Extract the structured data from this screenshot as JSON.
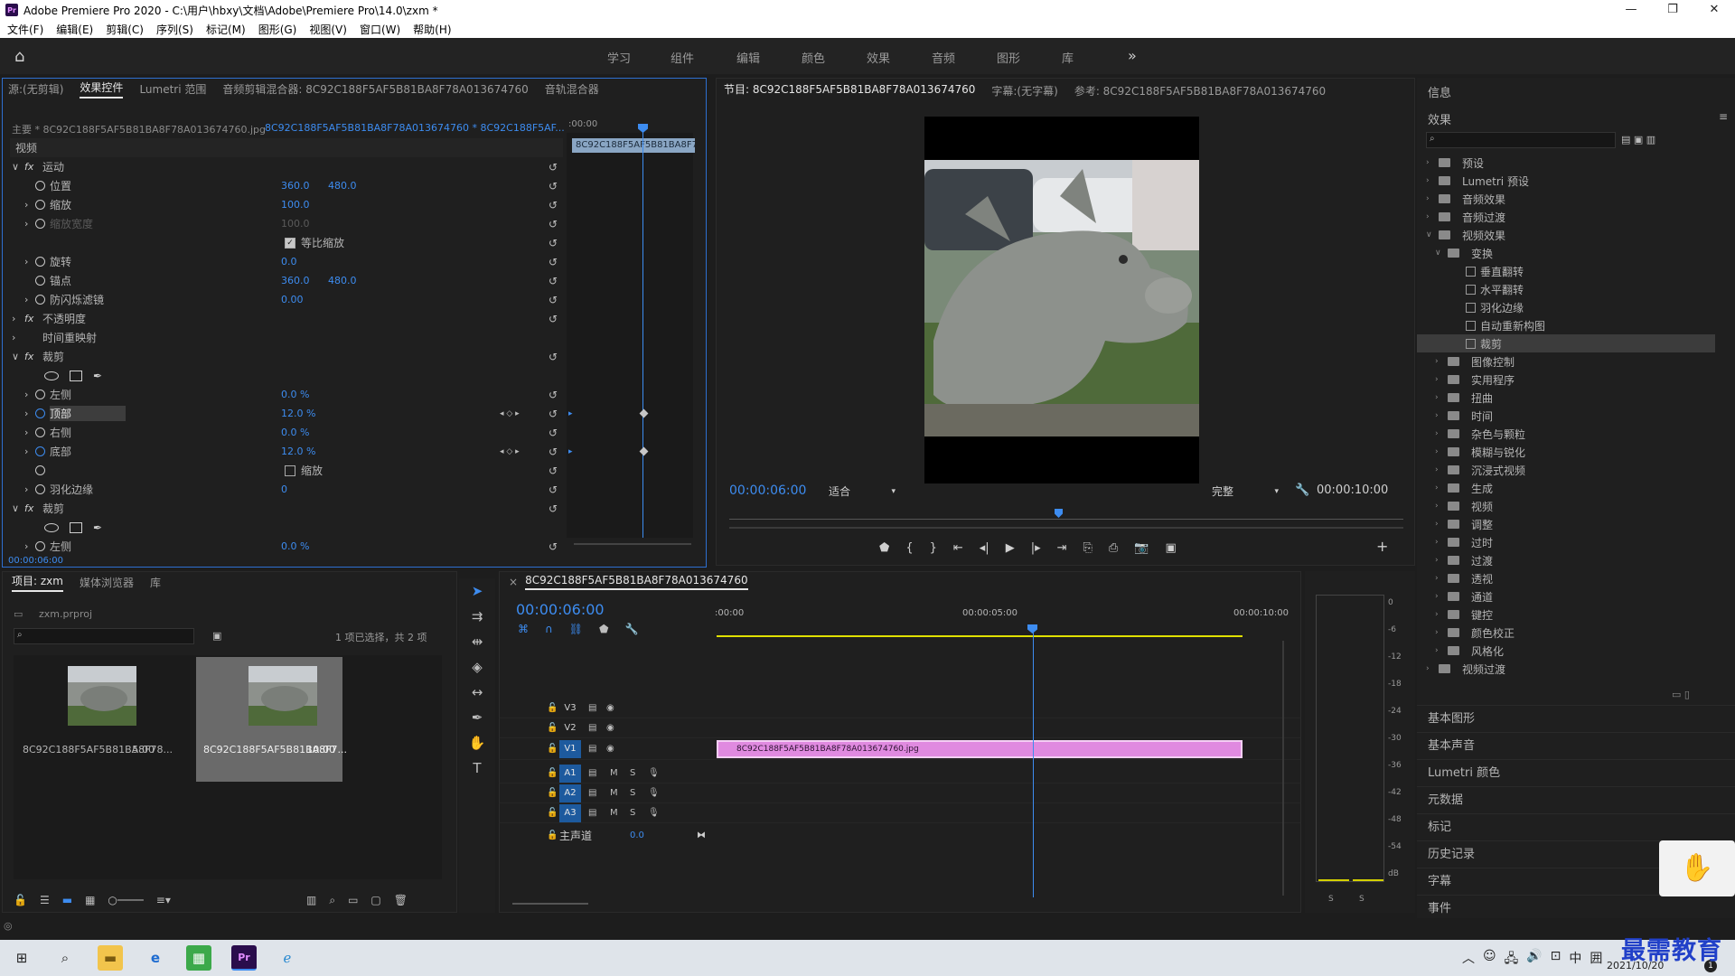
{
  "window": {
    "title": "Adobe Premiere Pro 2020 - C:\\用户\\hbxy\\文档\\Adobe\\Premiere Pro\\14.0\\zxm *",
    "logo": "Pr",
    "controls": [
      "—",
      "❐",
      "✕"
    ]
  },
  "menu": [
    "文件(F)",
    "编辑(E)",
    "剪辑(C)",
    "序列(S)",
    "标记(M)",
    "图形(G)",
    "视图(V)",
    "窗口(W)",
    "帮助(H)"
  ],
  "workspaces": [
    "学习",
    "组件",
    "编辑",
    "颜色",
    "效果",
    "音频",
    "图形",
    "库"
  ],
  "effect_controls": {
    "tabs": [
      "源:(无剪辑)",
      "效果控件",
      "Lumetri 范围",
      "音频剪辑混合器: 8C92C188F5AF5B81BA8F78A013674760",
      "音轨混合器"
    ],
    "source_label": "主要 * 8C92C188F5AF5B81BA8F78A013674760.jpg",
    "clip_label": "8C92C188F5AF5B81BA8F78A013674760 * 8C92C188F5AF...",
    "timecode_start": ":00:00",
    "clip_bar": "8C92C188F5AF5B81BA8F7",
    "bottom_time": "00:00:06:00",
    "section_video": "视频",
    "rows": [
      {
        "type": "fx",
        "label": "运动",
        "indent": 0,
        "arrow": "∨",
        "reset": true
      },
      {
        "type": "prop",
        "label": "位置",
        "v1": "360.0",
        "v2": "480.0",
        "reset": true
      },
      {
        "type": "prop",
        "label": "缩放",
        "v1": "100.0",
        "arrow": "›",
        "reset": true
      },
      {
        "type": "prop",
        "label": "缩放宽度",
        "v1": "100.0",
        "arrow": "›",
        "disabled": true,
        "reset": true
      },
      {
        "type": "check",
        "label": "等比缩放",
        "checked": true,
        "reset": true
      },
      {
        "type": "prop",
        "label": "旋转",
        "v1": "0.0",
        "arrow": "›",
        "reset": true
      },
      {
        "type": "prop",
        "label": "锚点",
        "v1": "360.0",
        "v2": "480.0",
        "reset": true
      },
      {
        "type": "prop",
        "label": "防闪烁滤镜",
        "v1": "0.00",
        "arrow": "›",
        "reset": true
      },
      {
        "type": "fx",
        "label": "不透明度",
        "arrow": "›",
        "reset": true
      },
      {
        "type": "fx",
        "label": "时间重映射",
        "arrow": "›",
        "nofx": true
      },
      {
        "type": "fx",
        "label": "裁剪",
        "arrow": "∨",
        "reset": true
      },
      {
        "type": "shapes"
      },
      {
        "type": "prop",
        "label": "左侧",
        "v1": "0.0 %",
        "arrow": "›",
        "reset": true
      },
      {
        "type": "prop",
        "label": "顶部",
        "v1": "12.0 %",
        "arrow": "›",
        "highlight": true,
        "animated": true,
        "reset": true
      },
      {
        "type": "prop",
        "label": "右侧",
        "v1": "0.0 %",
        "arrow": "›",
        "reset": true
      },
      {
        "type": "prop",
        "label": "底部",
        "v1": "12.0 %",
        "arrow": "›",
        "animated": true,
        "reset": true
      },
      {
        "type": "check",
        "label": "缩放",
        "checked": false,
        "reset": true
      },
      {
        "type": "prop",
        "label": "羽化边缘",
        "v1": "0",
        "arrow": "›",
        "reset": true
      },
      {
        "type": "fx",
        "label": "裁剪",
        "arrow": "∨",
        "reset": true
      },
      {
        "type": "shapes"
      },
      {
        "type": "prop",
        "label": "左侧",
        "v1": "0.0 %",
        "arrow": "›",
        "reset": true
      }
    ]
  },
  "program_monitor": {
    "tabs": [
      "节目: 8C92C188F5AF5B81BA8F78A013674760",
      "字幕:(无字幕)",
      "参考: 8C92C188F5AF5B81BA8F78A013674760"
    ],
    "timecode": "00:00:06:00",
    "fit": "适合",
    "quality": "完整",
    "duration": "00:00:10:00",
    "controls": [
      "⬟",
      "{",
      "}",
      "⇤",
      "◂|",
      "▶",
      "|▸",
      "⇥",
      "⎘",
      "⎙",
      "📷",
      "▣"
    ],
    "add": "+"
  },
  "right_panel": {
    "info": "信息",
    "effects": "效果",
    "search_placeholder": "",
    "tree": [
      {
        "label": "预设",
        "level": 0,
        "kind": "folder"
      },
      {
        "label": "Lumetri 预设",
        "level": 0,
        "kind": "folder"
      },
      {
        "label": "音频效果",
        "level": 0,
        "kind": "folder"
      },
      {
        "label": "音频过渡",
        "level": 0,
        "kind": "folder"
      },
      {
        "label": "视频效果",
        "level": 0,
        "kind": "folder",
        "open": true
      },
      {
        "label": "变换",
        "level": 1,
        "kind": "folder",
        "open": true
      },
      {
        "label": "垂直翻转",
        "level": 2,
        "kind": "fx"
      },
      {
        "label": "水平翻转",
        "level": 2,
        "kind": "fx"
      },
      {
        "label": "羽化边缘",
        "level": 2,
        "kind": "fx"
      },
      {
        "label": "自动重新构图",
        "level": 2,
        "kind": "fx"
      },
      {
        "label": "裁剪",
        "level": 2,
        "kind": "fx",
        "selected": true
      },
      {
        "label": "图像控制",
        "level": 1,
        "kind": "folder"
      },
      {
        "label": "实用程序",
        "level": 1,
        "kind": "folder"
      },
      {
        "label": "扭曲",
        "level": 1,
        "kind": "folder"
      },
      {
        "label": "时间",
        "level": 1,
        "kind": "folder"
      },
      {
        "label": "杂色与颗粒",
        "level": 1,
        "kind": "folder"
      },
      {
        "label": "模糊与锐化",
        "level": 1,
        "kind": "folder"
      },
      {
        "label": "沉浸式视频",
        "level": 1,
        "kind": "folder"
      },
      {
        "label": "生成",
        "level": 1,
        "kind": "folder"
      },
      {
        "label": "视频",
        "level": 1,
        "kind": "folder"
      },
      {
        "label": "调整",
        "level": 1,
        "kind": "folder"
      },
      {
        "label": "过时",
        "level": 1,
        "kind": "folder"
      },
      {
        "label": "过渡",
        "level": 1,
        "kind": "folder"
      },
      {
        "label": "透视",
        "level": 1,
        "kind": "folder"
      },
      {
        "label": "通道",
        "level": 1,
        "kind": "folder"
      },
      {
        "label": "键控",
        "level": 1,
        "kind": "folder"
      },
      {
        "label": "颜色校正",
        "level": 1,
        "kind": "folder"
      },
      {
        "label": "风格化",
        "level": 1,
        "kind": "folder"
      },
      {
        "label": "视频过渡",
        "level": 0,
        "kind": "folder"
      }
    ],
    "sections": [
      "基本图形",
      "基本声音",
      "Lumetri 颜色",
      "元数据",
      "标记",
      "历史记录",
      "字幕",
      "事件"
    ]
  },
  "project": {
    "tabs": [
      "项目: zxm",
      "媒体浏览器",
      "库"
    ],
    "file": "zxm.prproj",
    "selection": "1 项已选择，共 2 项",
    "items": [
      {
        "name": "8C92C188F5AF5B81BA8F78...",
        "duration": "5:00",
        "selected": false
      },
      {
        "name": "8C92C188F5AF5B81BA8F7...",
        "duration": "10:00",
        "selected": true
      }
    ]
  },
  "timeline": {
    "title": "8C92C188F5AF5B81BA8F78A013674760",
    "timecode": "00:00:06:00",
    "ruler": [
      ":00:00",
      "00:00:05:00",
      "00:00:10:00"
    ],
    "video_tracks": [
      "V3",
      "V2",
      "V1"
    ],
    "audio_tracks": [
      "A1",
      "A2",
      "A3"
    ],
    "master": "主声道",
    "master_value": "0.0",
    "clip": "8C92C188F5AF5B81BA8F78A013674760.jpg"
  },
  "audio_meter": {
    "scale": [
      "0",
      "-6",
      "-12",
      "-18",
      "-24",
      "-30",
      "-36",
      "-42",
      "-48",
      "-54",
      "dB"
    ],
    "solo": [
      "S",
      "S"
    ]
  },
  "taskbar": {
    "clock_time": "",
    "clock_date": "2021/10/20",
    "tray": [
      "︿",
      "☺",
      "🖧",
      "🔊",
      "⊡",
      "中",
      "囲"
    ],
    "notification": "1"
  },
  "watermark": "最需教育"
}
